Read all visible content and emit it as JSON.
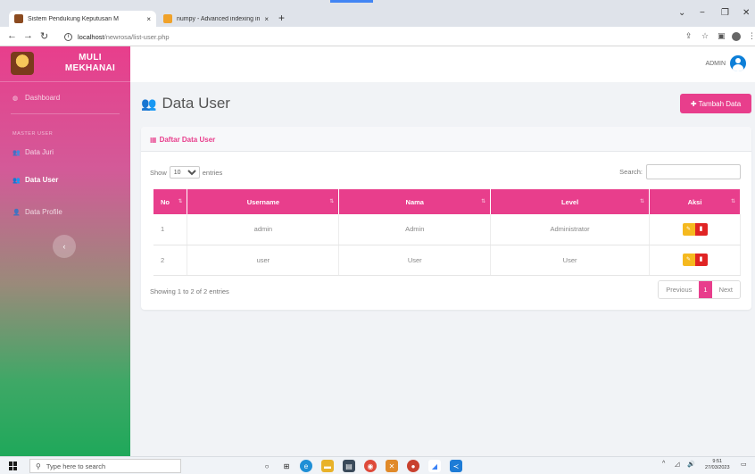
{
  "browser": {
    "tabs": [
      {
        "title": "Sistem Pendukung Keputusan M",
        "close": "×"
      },
      {
        "title": "numpy - Advanced indexing in T",
        "close": "×"
      }
    ],
    "new_tab": "+",
    "url_host": "localhost",
    "url_path": "/newrosa/list-user.php"
  },
  "brand": {
    "line1": "MULI",
    "line2": "MEKHANAI"
  },
  "sidebar": {
    "dashboard": "Dashboard",
    "section_header": "MASTER USER",
    "items": [
      "Data Juri",
      "Data User",
      "Data Profile"
    ]
  },
  "topbar": {
    "user_label": "ADMIN"
  },
  "page": {
    "title": "Data User",
    "add_button": "Tambah Data"
  },
  "card": {
    "title": "Daftar Data User"
  },
  "controls": {
    "show_label": "Show",
    "entries_label": "entries",
    "page_length": "10",
    "search_label": "Search:"
  },
  "table": {
    "headers": [
      "No",
      "Username",
      "Nama",
      "Level",
      "Aksi"
    ],
    "rows": [
      [
        "1",
        "admin",
        "Admin",
        "Administrator"
      ],
      [
        "2",
        "user",
        "User",
        "User"
      ]
    ]
  },
  "footer": {
    "info": "Showing 1 to 2 of 2 entries",
    "previous": "Previous",
    "current_page": "1",
    "next": "Next"
  },
  "taskbar": {
    "search_placeholder": "Type here to search",
    "time": "9:51",
    "date": "27/03/2023"
  },
  "colors": {
    "accent": "#e83e8c",
    "edit": "#f5b91f",
    "delete": "#e02424",
    "avatar": "#0d7fd8"
  }
}
